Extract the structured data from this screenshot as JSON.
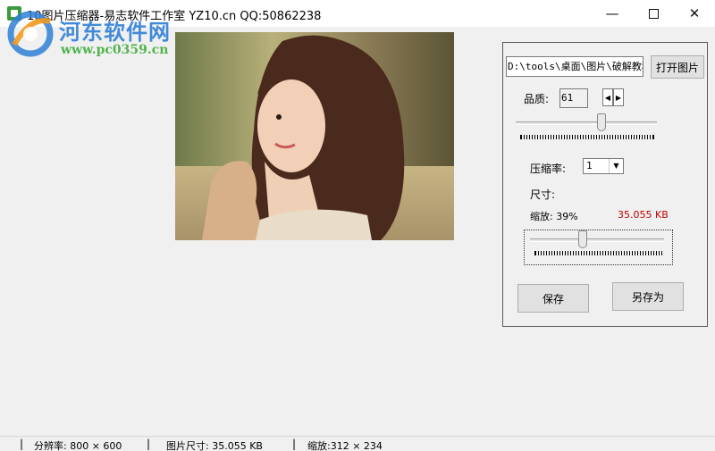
{
  "window": {
    "title": "10图片压缩器-易志软件工作室 YZ10.cn   QQ:50862238",
    "minimize_glyph": "—",
    "close_glyph": "✕"
  },
  "watermark": {
    "name": "河东软件网",
    "url": "www.pc0359.cn"
  },
  "panel": {
    "path_value": "D:\\tools\\桌面\\图片\\破解教程",
    "open_button": "打开图片",
    "quality_label": "品质:",
    "quality_value": "61",
    "quality_slider_level": 0.61,
    "ratio_label": "压缩率:",
    "ratio_value": "1",
    "size_label": "尺寸:",
    "scale_label": "缩放: 39%",
    "result_size": "35.055 KB",
    "scale_slider_level": 0.39,
    "save_button": "保存",
    "saveas_button": "另存为"
  },
  "statusbar": {
    "separator": "|",
    "resolution": "分辨率: 800 × 600",
    "file_size": "图片尺寸: 35.055 KB",
    "scaled": "缩放:312 × 234"
  },
  "colors": {
    "result_text": "#c00000",
    "watermark_blue": "#2f7fd6",
    "watermark_green": "#3fae3c"
  },
  "icons": [
    "app-icon",
    "minimize-icon",
    "maximize-icon",
    "close-icon",
    "spin-left-icon",
    "spin-right-icon",
    "dropdown-arrow-icon"
  ]
}
